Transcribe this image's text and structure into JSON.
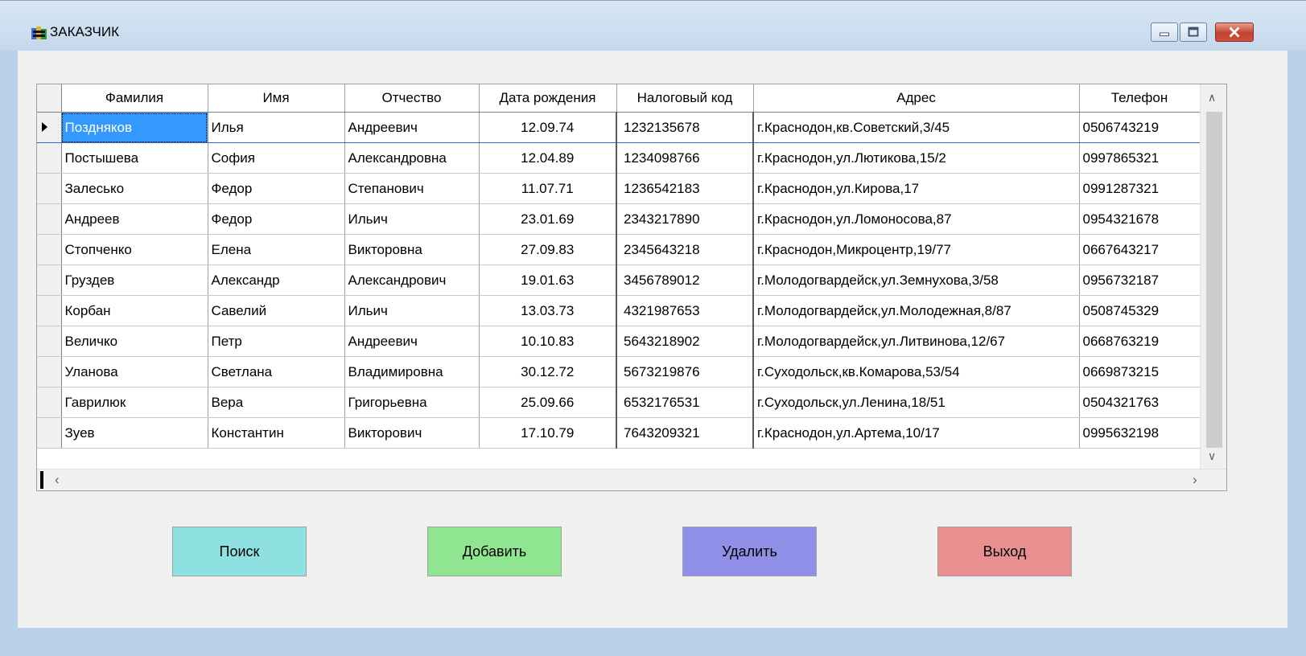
{
  "window": {
    "title": "ЗАКАЗЧИК",
    "icon": "app-icon"
  },
  "grid": {
    "columns": [
      "Фамилия",
      "Имя",
      "Отчество",
      "Дата рождения",
      "Налоговый код",
      "Адрес",
      "Телефон"
    ],
    "current_row": 0,
    "rows": [
      [
        "Поздняков",
        "Илья",
        "Андреевич",
        "12.09.74",
        "1232135678",
        "г.Краснодон,кв.Советский,3/45",
        "0506743219"
      ],
      [
        "Постышева",
        "София",
        "Александровна",
        "12.04.89",
        "1234098766",
        "г.Краснодон,ул.Лютикова,15/2",
        "0997865321"
      ],
      [
        "Залесько",
        "Федор",
        "Степанович",
        "11.07.71",
        "1236542183",
        "г.Краснодон,ул.Кирова,17",
        "0991287321"
      ],
      [
        "Андреев",
        "Федор",
        "Ильич",
        "23.01.69",
        "2343217890",
        "г.Краснодон,ул.Ломоносова,87",
        "0954321678"
      ],
      [
        "Стопченко",
        "Елена",
        "Викторовна",
        "27.09.83",
        "2345643218",
        "г.Краснодон,Микроцентр,19/77",
        "0667643217"
      ],
      [
        "Груздев",
        "Александр",
        "Александрович",
        "19.01.63",
        "3456789012",
        "г.Молодогвардейск,ул.Земнухова,3/58",
        "0956732187"
      ],
      [
        "Корбан",
        "Савелий",
        "Ильич",
        "13.03.73",
        "4321987653",
        "г.Молодогвардейск,ул.Молодежная,8/87",
        "0508745329"
      ],
      [
        "Величко",
        "Петр",
        "Андреевич",
        "10.10.83",
        "5643218902",
        "г.Молодогвардейск,ул.Литвинова,12/67",
        "0668763219"
      ],
      [
        "Уланова",
        "Светлана",
        "Владимировна",
        "30.12.72",
        "5673219876",
        "г.Суходольск,кв.Комарова,53/54",
        "0669873215"
      ],
      [
        "Гаврилюк",
        "Вера",
        "Григорьевна",
        "25.09.66",
        "6532176531",
        "г.Суходольск,ул.Ленина,18/51",
        "0504321763"
      ],
      [
        "Зуев",
        "Константин",
        "Викторович",
        "17.10.79",
        "7643209321",
        "г.Краснодон,ул.Артема,10/17",
        "0995632198"
      ]
    ]
  },
  "buttons": {
    "search": "Поиск",
    "add": "Добавить",
    "delete": "Удалить",
    "exit": "Выход"
  },
  "colors": {
    "search": "#8fe1e1",
    "add": "#90e590",
    "delete": "#8f8fe8",
    "exit": "#e89090",
    "selection": "#3399ff"
  }
}
